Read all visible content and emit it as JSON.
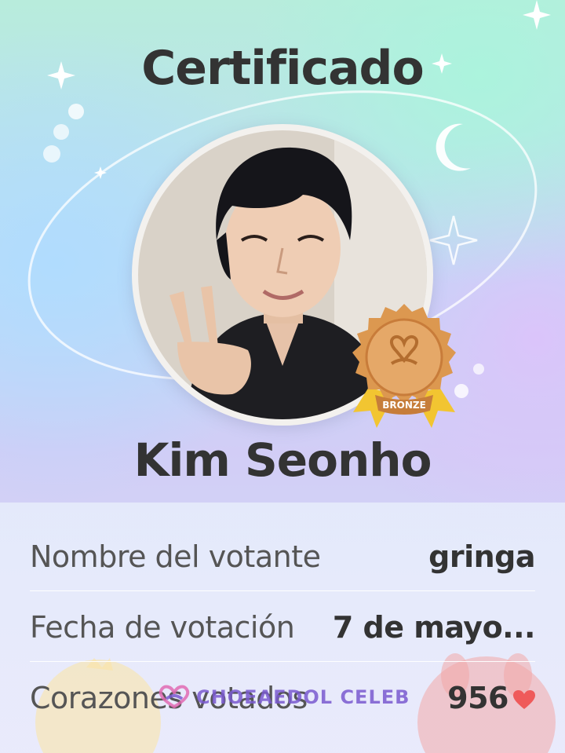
{
  "certificate": {
    "title": "Certificado",
    "celebrity_name": "Kim Seonho",
    "badge_level": "BRONZE",
    "photo_description_icon": "celebrity-portrait"
  },
  "details": {
    "voter_label": "Nombre del votante",
    "voter_value": "gringa",
    "date_label": "Fecha de votación",
    "date_value": "7 de mayo...",
    "hearts_label": "Corazones votados",
    "hearts_value": "956"
  },
  "watermark": {
    "brand": "CHOEAEDOL CELEB"
  },
  "colors": {
    "title_text": "#333333",
    "badge_bronze": "#d8914e",
    "badge_ribbon": "#f2c531",
    "heart": "#ef5a5a",
    "brand": "#7a5ad0"
  }
}
